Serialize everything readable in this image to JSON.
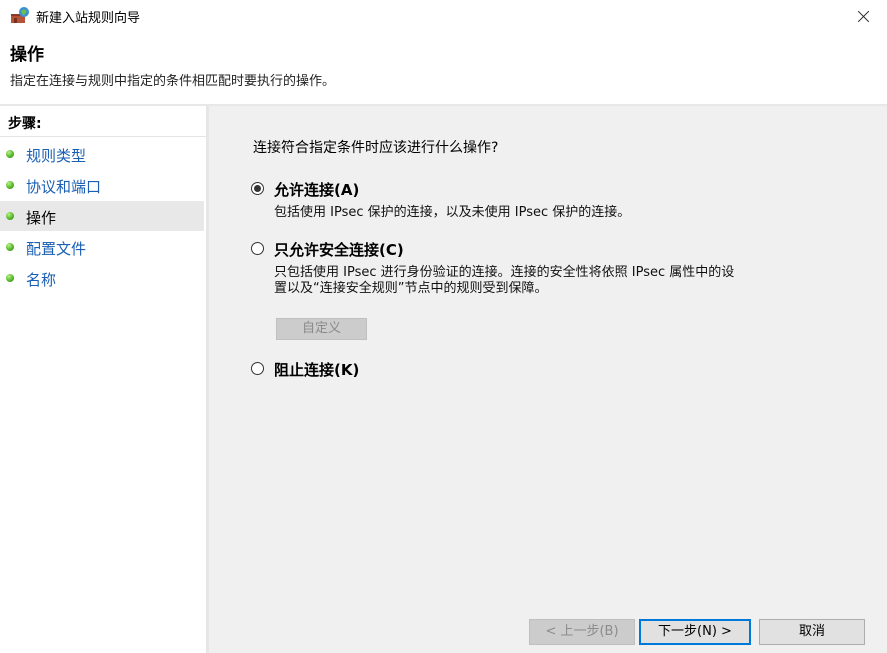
{
  "window": {
    "title": "新建入站规则向导",
    "icon": "firewall-wizard-icon"
  },
  "header": {
    "title": "操作",
    "description": "指定在连接与规则中指定的条件相匹配时要执行的操作。"
  },
  "sidebar": {
    "heading": "步骤:",
    "items": [
      {
        "label": "规则类型",
        "active": false
      },
      {
        "label": "协议和端口",
        "active": false
      },
      {
        "label": "操作",
        "active": true
      },
      {
        "label": "配置文件",
        "active": false
      },
      {
        "label": "名称",
        "active": false
      }
    ]
  },
  "main": {
    "question": "连接符合指定条件时应该进行什么操作?",
    "options": [
      {
        "label": "允许连接(A)",
        "description": "包括使用 IPsec 保护的连接，以及未使用 IPsec 保护的连接。",
        "checked": true
      },
      {
        "label": "只允许安全连接(C)",
        "description_line1": "只包括使用 IPsec 进行身份验证的连接。连接的安全性将依照 IPsec 属性中的设",
        "description_line2": "置以及“连接安全规则”节点中的规则受到保障。",
        "checked": false
      },
      {
        "label": "阻止连接(K)",
        "checked": false
      }
    ],
    "customize_label": "自定义"
  },
  "footer": {
    "back_label": "< 上一步(B)",
    "next_label": "下一步(N) >",
    "cancel_label": "取消"
  }
}
